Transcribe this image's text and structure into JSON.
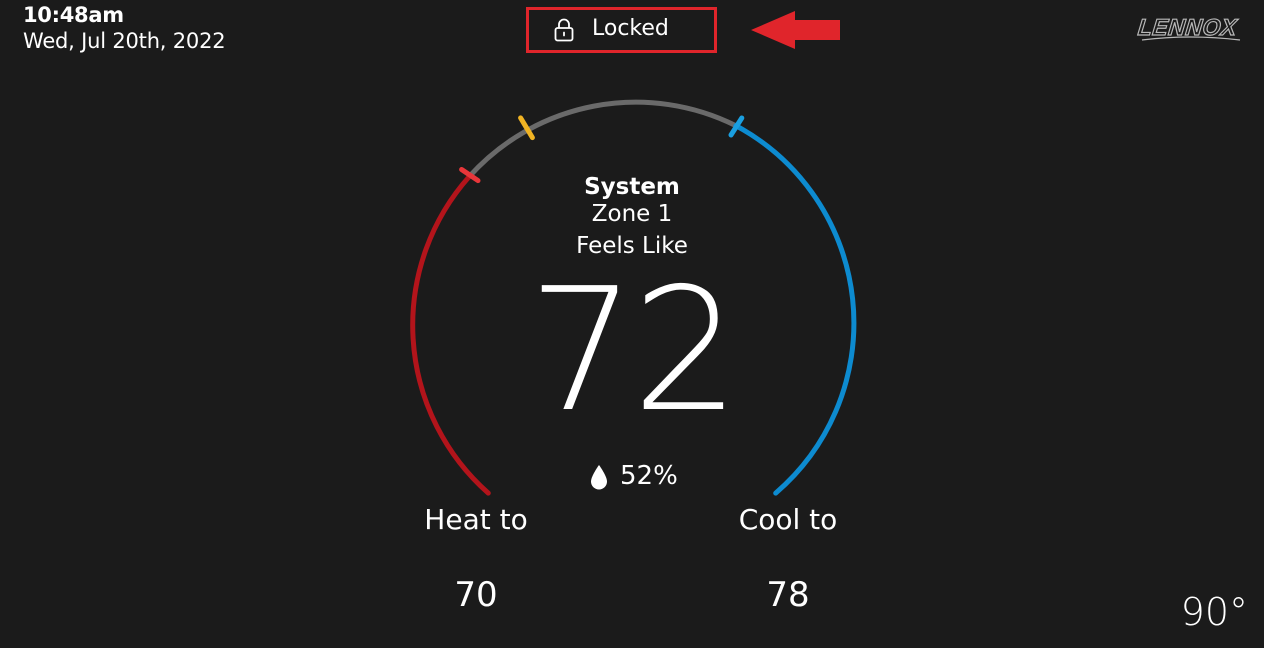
{
  "header": {
    "time": "10:48am",
    "date": "Wed, Jul 20th, 2022",
    "lock_status": "Locked",
    "brand": "LENNOX"
  },
  "dial": {
    "system_label": "System",
    "zone_label": "Zone 1",
    "feels_like_label": "Feels Like",
    "indoor_temp": "72",
    "humidity": "52%"
  },
  "setpoints": {
    "heat_label": "Heat to",
    "heat_value": "70",
    "cool_label": "Cool to",
    "cool_value": "78"
  },
  "outdoor_temp": "90°",
  "icons": {
    "lock": "lock-icon",
    "humidity": "water-drop-icon",
    "annotation": "arrow-left-icon"
  },
  "colors": {
    "background": "#1b1b1b",
    "heat": "#b3141b",
    "cool": "#0d8bd0",
    "neutral_arc": "#6a6a6a",
    "heat_marker": "#e8363a",
    "indoor_marker": "#f0b323",
    "cool_marker": "#1a9fe0",
    "highlight": "#e0252b"
  }
}
